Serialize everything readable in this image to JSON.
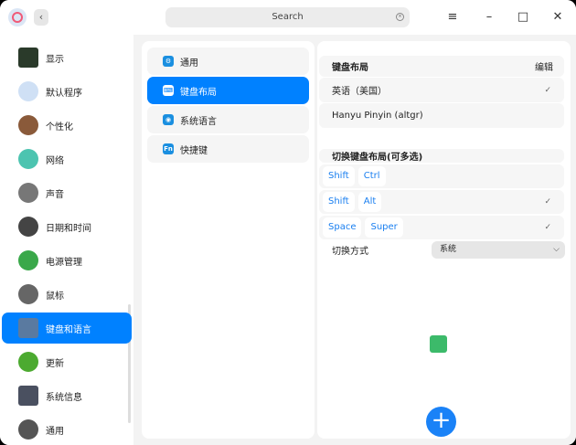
{
  "search": {
    "placeholder": "Search"
  },
  "window": {
    "minimize": "–",
    "maximize": "□",
    "close": "✕",
    "menu": "≡",
    "back": "‹"
  },
  "sidebar": {
    "items": [
      {
        "label": "显示",
        "icon": "display-icon",
        "color": "#2a3a2a"
      },
      {
        "label": "默认程序",
        "icon": "default-apps-icon",
        "color": "#cfe0f5"
      },
      {
        "label": "个性化",
        "icon": "personalization-icon",
        "color": "#8a5a3a"
      },
      {
        "label": "网络",
        "icon": "network-icon",
        "color": "#4cc4b0"
      },
      {
        "label": "声音",
        "icon": "sound-icon",
        "color": "#777777"
      },
      {
        "label": "日期和时间",
        "icon": "clock-icon",
        "color": "#444444"
      },
      {
        "label": "电源管理",
        "icon": "power-icon",
        "color": "#3aa84a"
      },
      {
        "label": "鼠标",
        "icon": "mouse-icon",
        "color": "#666666"
      },
      {
        "label": "键盘和语言",
        "icon": "keyboard-icon",
        "color": "#5a7aa0"
      },
      {
        "label": "更新",
        "icon": "update-icon",
        "color": "#4caa30"
      },
      {
        "label": "系统信息",
        "icon": "system-info-icon",
        "color": "#4a5060"
      },
      {
        "label": "通用",
        "icon": "general-icon",
        "color": "#555555"
      }
    ],
    "selected": 8
  },
  "middle": {
    "items": [
      {
        "label": "通用",
        "icon": "gear-icon",
        "glyph": "⚙"
      },
      {
        "label": "键盘布局",
        "icon": "keyboard-icon",
        "glyph": "⌨"
      },
      {
        "label": "系统语言",
        "icon": "globe-icon",
        "glyph": "◉"
      },
      {
        "label": "快捷键",
        "icon": "fn-icon",
        "glyph": "Fn"
      }
    ],
    "selected": 1
  },
  "layouts": {
    "title": "键盘布局",
    "edit": "编辑",
    "items": [
      {
        "label": "英语（美国）",
        "checked": "✓"
      },
      {
        "label": "Hanyu Pinyin (altgr)",
        "checked": ""
      }
    ]
  },
  "switch": {
    "title": "切换键盘布局(可多选)",
    "combos": [
      {
        "keys": [
          "Shift",
          "Ctrl"
        ],
        "checked": ""
      },
      {
        "keys": [
          "Shift",
          "Alt"
        ],
        "checked": "✓"
      },
      {
        "keys": [
          "Space",
          "Super"
        ],
        "checked": "✓"
      }
    ],
    "method_label": "切换方式",
    "method_value": "系统"
  },
  "add": "+"
}
